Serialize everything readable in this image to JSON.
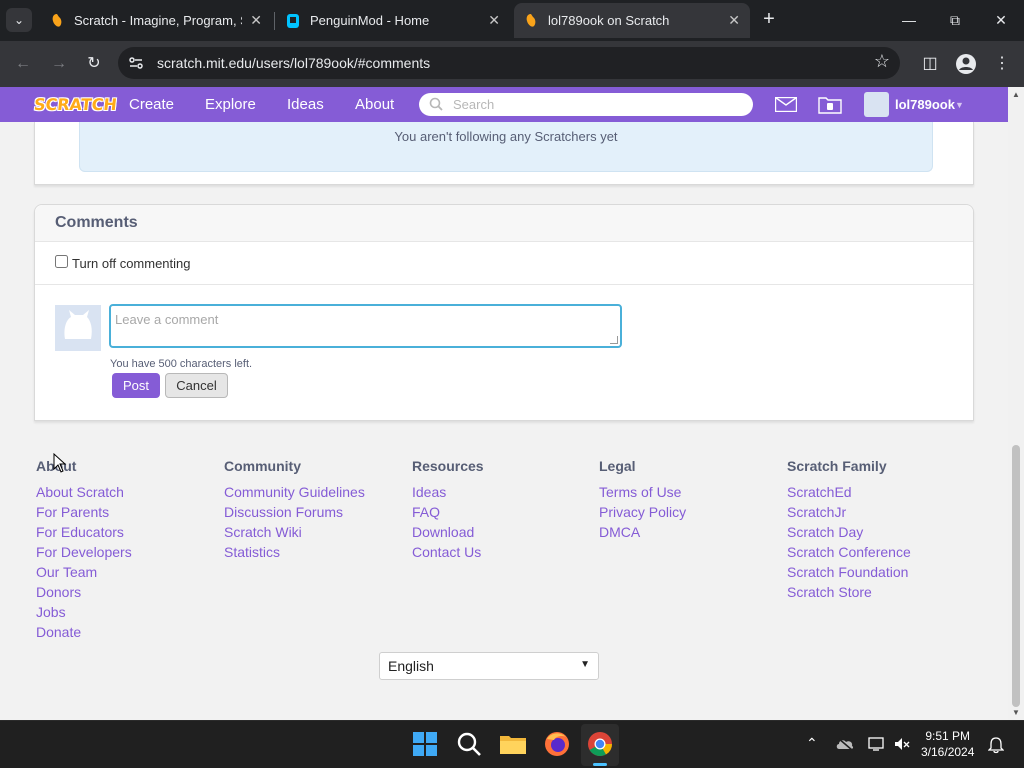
{
  "browser": {
    "tabs": [
      {
        "title": "Scratch - Imagine, Program, Share",
        "favicon": "scratch-favicon",
        "active": false
      },
      {
        "title": "PenguinMod - Home",
        "favicon": "penguinmod-favicon",
        "active": false
      },
      {
        "title": "lol789ook on Scratch",
        "favicon": "scratch-favicon",
        "active": true
      }
    ],
    "url": "scratch.mit.edu/users/lol789ook/#comments"
  },
  "nav": {
    "logo": "SCRATCH",
    "create": "Create",
    "explore": "Explore",
    "ideas": "Ideas",
    "about": "About",
    "search_placeholder": "Search",
    "username": "lol789ook"
  },
  "following": {
    "empty_text": "You aren't following any Scratchers yet"
  },
  "comments": {
    "title": "Comments",
    "toggle_label": "Turn off commenting",
    "input_placeholder": "Leave a comment",
    "chars_left": "You have 500 characters left.",
    "post_label": "Post",
    "cancel_label": "Cancel"
  },
  "footer": {
    "columns": [
      {
        "heading": "About",
        "links": [
          "About Scratch",
          "For Parents",
          "For Educators",
          "For Developers",
          "Our Team",
          "Donors",
          "Jobs",
          "Donate"
        ]
      },
      {
        "heading": "Community",
        "links": [
          "Community Guidelines",
          "Discussion Forums",
          "Scratch Wiki",
          "Statistics"
        ]
      },
      {
        "heading": "Resources",
        "links": [
          "Ideas",
          "FAQ",
          "Download",
          "Contact Us"
        ]
      },
      {
        "heading": "Legal",
        "links": [
          "Terms of Use",
          "Privacy Policy",
          "DMCA"
        ]
      },
      {
        "heading": "Scratch Family",
        "links": [
          "ScratchEd",
          "ScratchJr",
          "Scratch Day",
          "Scratch Conference",
          "Scratch Foundation",
          "Scratch Store"
        ]
      }
    ],
    "language": "English"
  },
  "taskbar": {
    "time": "9:51 PM",
    "date": "3/16/2024"
  },
  "colors": {
    "scratch_purple": "#855cd6",
    "link_purple": "#855cd6",
    "focus_blue": "#4ab0d9"
  }
}
